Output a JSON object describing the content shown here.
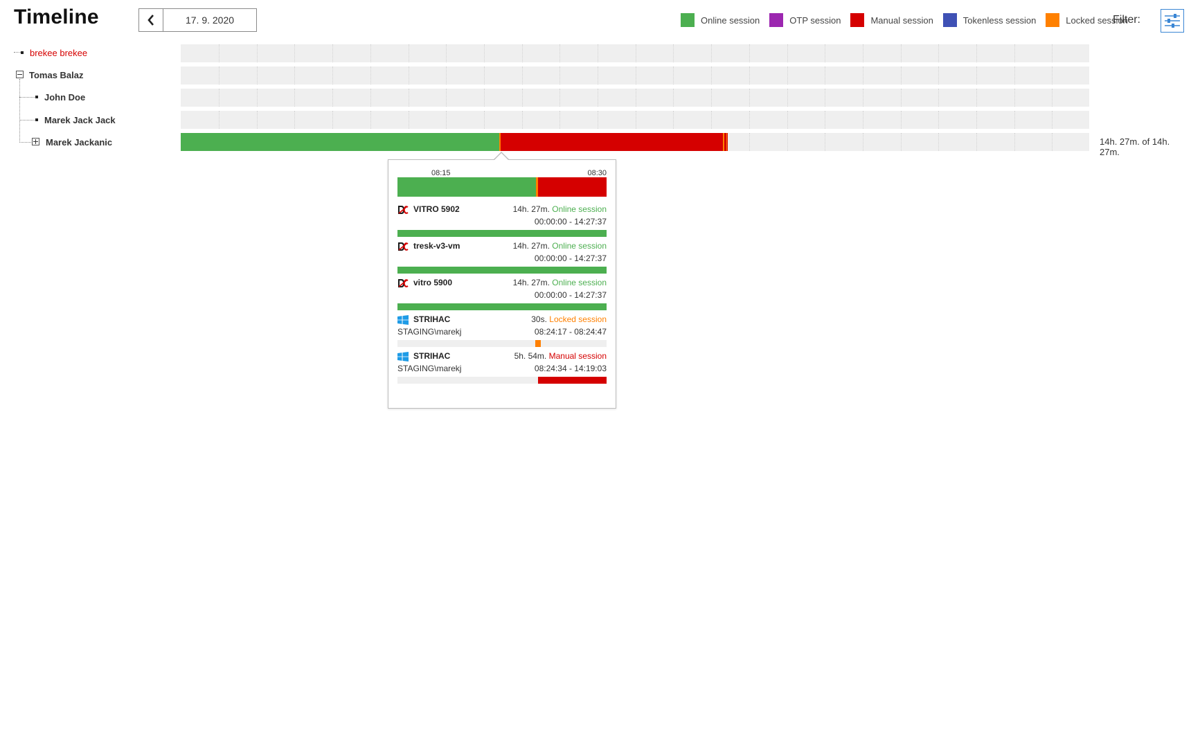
{
  "header": {
    "title": "Timeline",
    "date": "17. 9. 2020",
    "filter_label": "Filter:"
  },
  "legend": [
    {
      "label": "Online session",
      "color": "#4caf50"
    },
    {
      "label": "OTP session",
      "color": "#9c27b0"
    },
    {
      "label": "Manual session",
      "color": "#d50000"
    },
    {
      "label": "Tokenless session",
      "color": "#3f51b5"
    },
    {
      "label": "Locked session",
      "color": "#ff8000"
    }
  ],
  "tree": [
    {
      "label": "brekee brekee",
      "color": "#d50000"
    },
    {
      "label": "Tomas Balaz",
      "color": "#333333"
    },
    {
      "label": "John Doe",
      "color": "#333333"
    },
    {
      "label": "Marek Jack Jack",
      "color": "#333333"
    },
    {
      "label": "Marek Jackanic",
      "color": "#333333"
    }
  ],
  "timeline": {
    "total_label": "14h. 27m. of 14h. 27m."
  },
  "tooltip": {
    "time_start": "08:15",
    "time_end": "08:30",
    "entries": [
      {
        "name": "VITRO 5902",
        "icon": "dc-icon",
        "duration": "14h. 27m.",
        "type": "Online session",
        "type_color": "#4caf50",
        "user": "",
        "range": "00:00:00 - 14:27:37",
        "fill_start": 0,
        "fill_end": 1,
        "fill_color": "#4caf50"
      },
      {
        "name": "tresk-v3-vm",
        "icon": "dc-icon",
        "duration": "14h. 27m.",
        "type": "Online session",
        "type_color": "#4caf50",
        "user": "",
        "range": "00:00:00 - 14:27:37",
        "fill_start": 0,
        "fill_end": 1,
        "fill_color": "#4caf50"
      },
      {
        "name": "vitro 5900",
        "icon": "dc-icon",
        "duration": "14h. 27m.",
        "type": "Online session",
        "type_color": "#4caf50",
        "user": "",
        "range": "00:00:00 - 14:27:37",
        "fill_start": 0,
        "fill_end": 1,
        "fill_color": "#4caf50"
      },
      {
        "name": "STRIHAC",
        "icon": "windows-icon",
        "duration": "30s.",
        "type": "Locked session",
        "type_color": "#ff8000",
        "user": "STAGING\\marekj",
        "range": "08:24:17 - 08:24:47",
        "fill_start": 0.658,
        "fill_end": 0.685,
        "fill_color": "#ff8000"
      },
      {
        "name": "STRIHAC",
        "icon": "windows-icon",
        "duration": "5h. 54m.",
        "type": "Manual session",
        "type_color": "#d50000",
        "user": "STAGING\\marekj",
        "range": "08:24:34 - 14:19:03",
        "fill_start": 0.672,
        "fill_end": 1,
        "fill_color": "#d50000"
      }
    ]
  }
}
